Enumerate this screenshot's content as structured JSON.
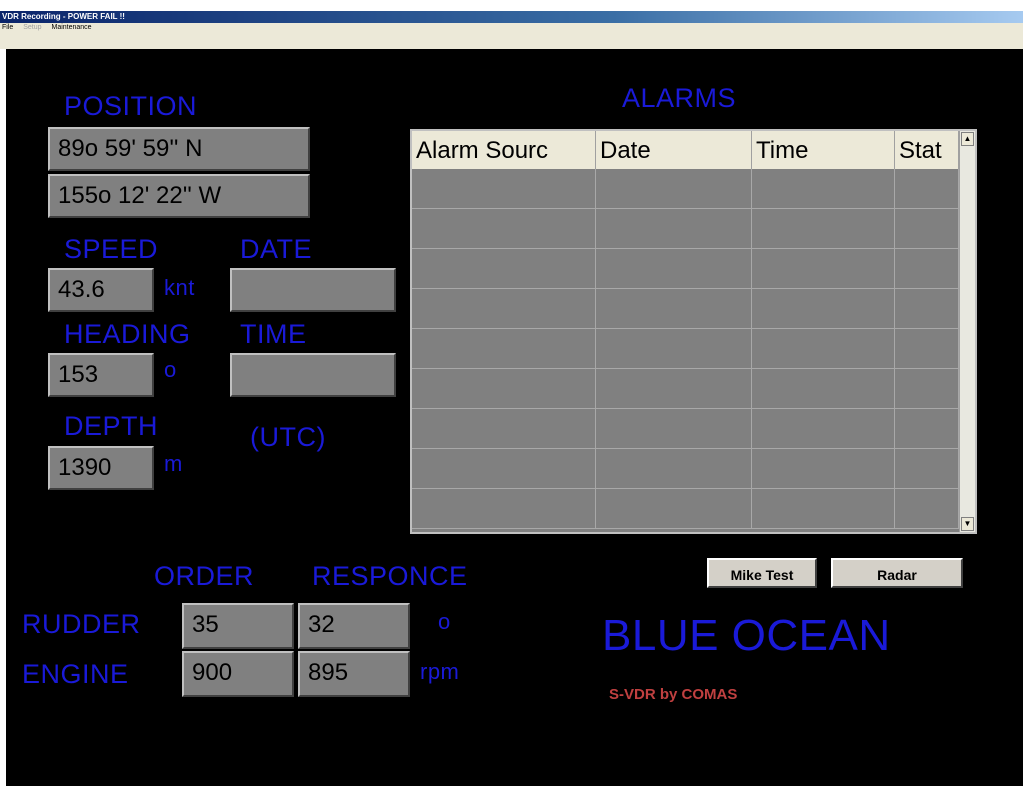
{
  "window": {
    "title": "VDR Recording - POWER FAIL !!"
  },
  "menu": {
    "file": "File",
    "setup": "Setup",
    "maintenance": "Maintenance"
  },
  "position": {
    "label": "POSITION",
    "lat": "89o 59' 59'' N",
    "lon": "155o 12' 22'' W"
  },
  "speed": {
    "label": "SPEED",
    "value": "43.6",
    "unit": "knt"
  },
  "date": {
    "label": "DATE",
    "value": ""
  },
  "heading": {
    "label": "HEADING",
    "value": "153",
    "unit": "o"
  },
  "time": {
    "label": "TIME",
    "value": "",
    "tz": "(UTC)"
  },
  "depth": {
    "label": "DEPTH",
    "value": "1390",
    "unit": "m"
  },
  "alarms": {
    "title": "ALARMS",
    "columns": [
      "Alarm Sourc",
      "Date",
      "Time",
      "Stat"
    ],
    "row_count": 9
  },
  "control": {
    "order_label": "ORDER",
    "response_label": "RESPONCE",
    "rudder": {
      "label": "RUDDER",
      "order": "35",
      "response": "32",
      "unit": "o"
    },
    "engine": {
      "label": "ENGINE",
      "order": "900",
      "response": "895",
      "unit": "rpm"
    }
  },
  "buttons": {
    "mike_test": "Mike Test",
    "radar": "Radar"
  },
  "brand": {
    "name": "BLUE OCEAN",
    "sub": "S-VDR by COMAS"
  },
  "colors": {
    "label": "#1a1ad8",
    "field": "#808080",
    "background": "#000000",
    "brand_sub": "#c04040"
  }
}
